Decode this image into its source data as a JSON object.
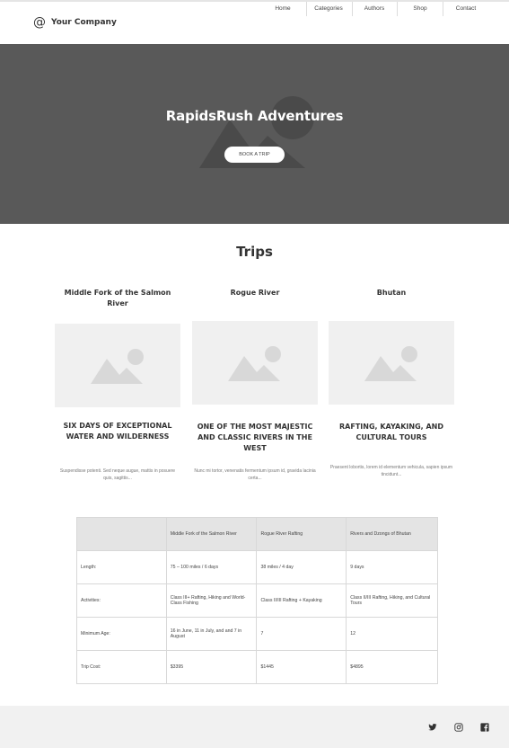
{
  "header": {
    "brand_icon": "@",
    "brand_name": "Your Company",
    "nav": [
      "Home",
      "Categories",
      "Authors",
      "Shop",
      "Contact"
    ]
  },
  "hero": {
    "title": "RapidsRush Adventures",
    "button_label": "BOOK A TRIP"
  },
  "trips": {
    "section_title": "Trips",
    "cards": [
      {
        "title": "Middle Fork of the Salmon River",
        "headline": "SIX DAYS OF EXCEPTIONAL WATER AND WILDERNESS",
        "text": "Suspendisse potenti. Sed neque augue, mattis in posuere quis, sagittis..."
      },
      {
        "title": "Rogue River",
        "headline": "ONE OF THE MOST MAJESTIC AND CLASSIC RIVERS IN THE WEST",
        "text": "Nunc mi tortor, venenatis fermentum ipsum id, gravida lacinia certa..."
      },
      {
        "title": "Bhutan",
        "headline": "RAFTING, KAYAKING, AND CULTURAL TOURS",
        "text": "Praesent lobortis, lorem id elementum vehicula, sapien ipsum tincidunt..."
      }
    ]
  },
  "table": {
    "headers": [
      "",
      "Middle Fork of the Salmon River",
      "Rogue River Rafting",
      "Rivers and Dzongs of Bhutan"
    ],
    "rows": [
      [
        "Length:",
        "75 – 100 miles / 6 days",
        "38 miles / 4 day",
        "9 days"
      ],
      [
        "Activities:",
        "Class III+ Rafting, Hiking and World-Class Fishing",
        "Class II/III Rafting + Kayaking",
        "Class II/III Rafting, Hiking, and Cultural Tours"
      ],
      [
        "Minimum Age:",
        "16 in June, 11 in July, and and 7 in August",
        "7",
        "12"
      ],
      [
        "Trip Cost:",
        "$3395",
        "$1445",
        "$4895"
      ]
    ]
  },
  "footer": {
    "social": [
      "twitter-icon",
      "instagram-icon",
      "facebook-icon"
    ]
  },
  "colors": {
    "hero_bg": "#595959",
    "placeholder_bg": "#f0f0f0",
    "table_head_bg": "#e4e4e4",
    "footer_bg": "#f1f1f1"
  }
}
